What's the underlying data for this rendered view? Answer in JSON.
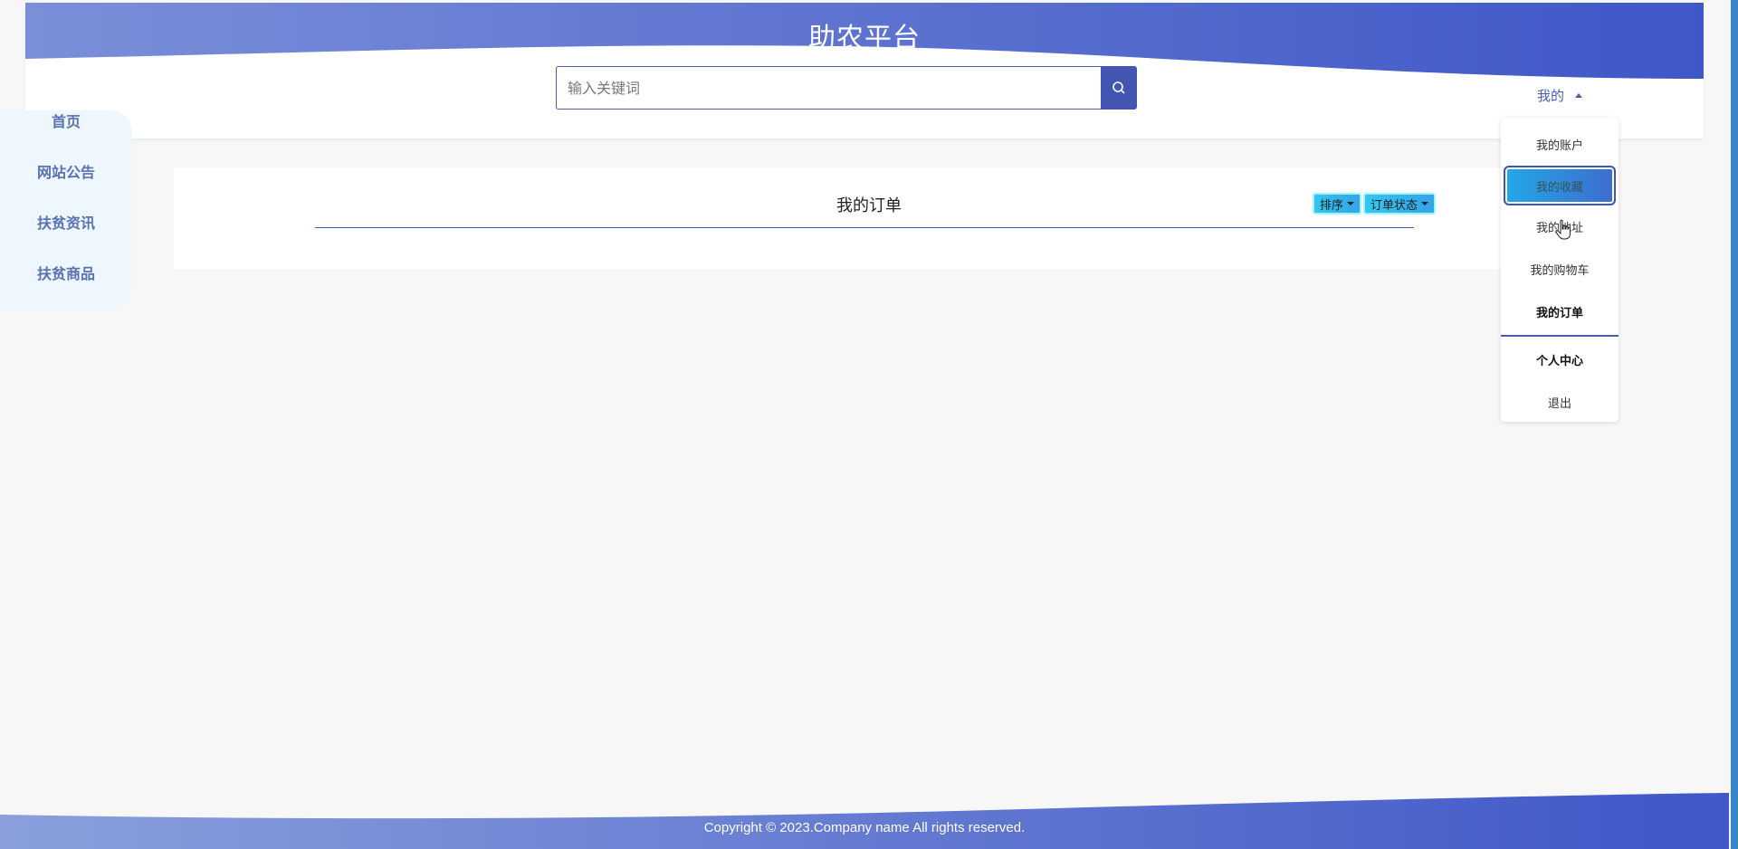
{
  "header": {
    "title": "助农平台",
    "search_placeholder": "输入关键词",
    "my_label": "我的"
  },
  "sidebar": {
    "items": [
      {
        "label": "首页"
      },
      {
        "label": "网站公告"
      },
      {
        "label": "扶贫资讯"
      },
      {
        "label": "扶贫商品"
      }
    ]
  },
  "main": {
    "title": "我的订单",
    "sort_label": "排序",
    "status_label": "订单状态"
  },
  "dropdown": {
    "items": [
      {
        "label": "我的账户"
      },
      {
        "label": "我的收藏"
      },
      {
        "label": "我的地址"
      },
      {
        "label": "我的购物车"
      },
      {
        "label": "我的订单"
      },
      {
        "label": "个人中心"
      },
      {
        "label": "退出"
      }
    ]
  },
  "footer": {
    "copyright": "Copyright © 2023.Company name All rights reserved."
  },
  "colors": {
    "brand": "#4356b4",
    "accent": "#35c5f0"
  }
}
